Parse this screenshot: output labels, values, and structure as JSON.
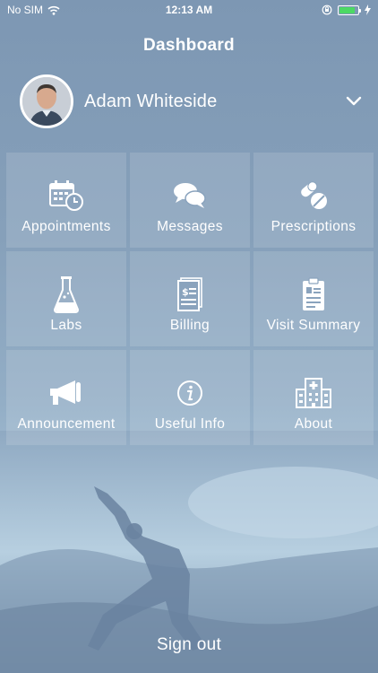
{
  "status_bar": {
    "carrier": "No SIM",
    "time": "12:13 AM",
    "battery_level": 0.85
  },
  "header": {
    "title": "Dashboard"
  },
  "profile": {
    "name": "Adam Whiteside"
  },
  "tiles": [
    {
      "label": "Appointments",
      "icon": "calendar-clock-icon"
    },
    {
      "label": "Messages",
      "icon": "chat-bubbles-icon"
    },
    {
      "label": "Prescriptions",
      "icon": "pills-icon"
    },
    {
      "label": "Labs",
      "icon": "flask-icon"
    },
    {
      "label": "Billing",
      "icon": "bill-icon"
    },
    {
      "label": "Visit Summary",
      "icon": "clipboard-icon"
    },
    {
      "label": "Announcement",
      "icon": "megaphone-icon"
    },
    {
      "label": "Useful Info",
      "icon": "info-icon"
    },
    {
      "label": "About",
      "icon": "hospital-icon"
    }
  ],
  "footer": {
    "signout_label": "Sign out"
  },
  "colors": {
    "text": "#ffffff",
    "tile_bg": "rgba(255,255,255,0.13)",
    "battery": "#4cd964"
  }
}
